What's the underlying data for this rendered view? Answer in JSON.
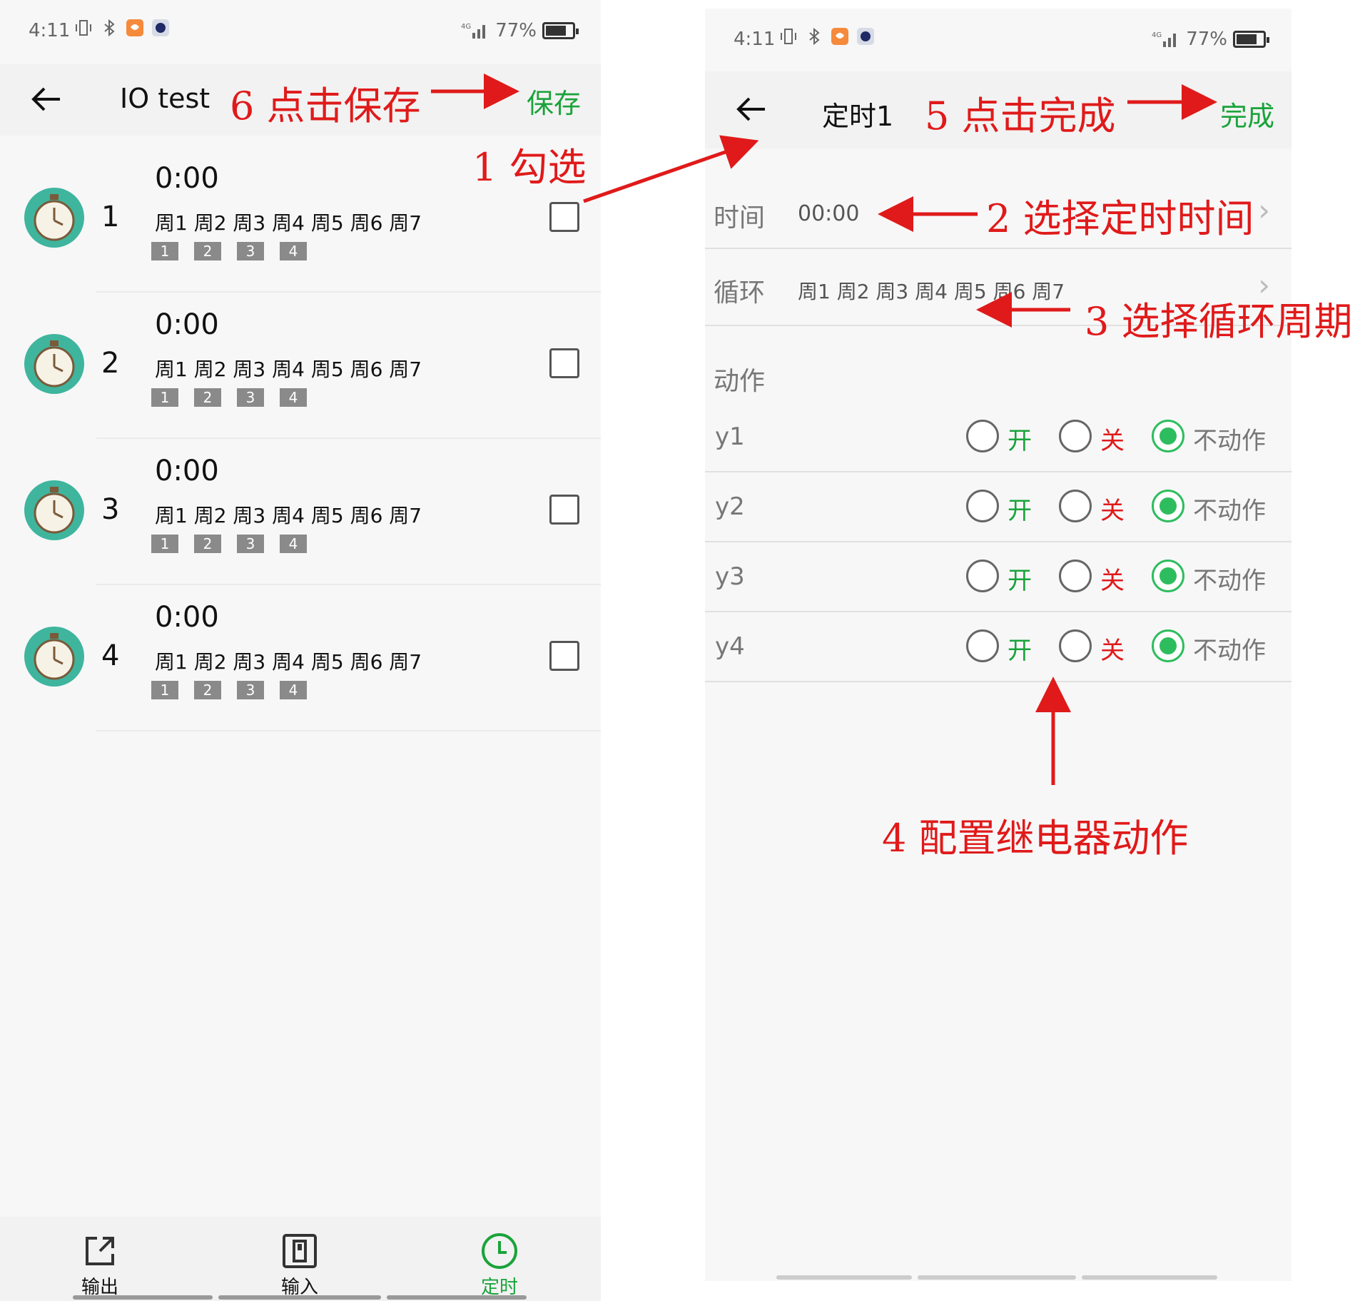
{
  "left": {
    "status": {
      "time": "4:11",
      "signal": "4G",
      "battery": "77%"
    },
    "toolbar": {
      "title": "IO test",
      "save": "保存"
    },
    "timers": [
      {
        "index": "1",
        "time": "0:00",
        "days": "周1 周2 周3 周4 周5 周6 周7",
        "relays": [
          "1",
          "2",
          "3",
          "4"
        ]
      },
      {
        "index": "2",
        "time": "0:00",
        "days": "周1 周2 周3 周4 周5 周6 周7",
        "relays": [
          "1",
          "2",
          "3",
          "4"
        ]
      },
      {
        "index": "3",
        "time": "0:00",
        "days": "周1 周2 周3 周4 周5 周6 周7",
        "relays": [
          "1",
          "2",
          "3",
          "4"
        ]
      },
      {
        "index": "4",
        "time": "0:00",
        "days": "周1 周2 周3 周4 周5 周6 周7",
        "relays": [
          "1",
          "2",
          "3",
          "4"
        ]
      }
    ],
    "nav": {
      "output": "输出",
      "input": "输入",
      "timer": "定时"
    }
  },
  "right": {
    "status": {
      "time": "4:11",
      "signal": "4G",
      "battery": "77%"
    },
    "toolbar": {
      "title": "定时1",
      "done": "完成"
    },
    "time_label": "时间",
    "time_value": "00:00",
    "cycle_label": "循环",
    "cycle_value": "周1 周2 周3 周4 周5 周6 周7",
    "action_label": "动作",
    "options": {
      "on": "开",
      "off": "关",
      "none": "不动作"
    },
    "actions": [
      {
        "name": "y1",
        "selected": "none"
      },
      {
        "name": "y2",
        "selected": "none"
      },
      {
        "name": "y3",
        "selected": "none"
      },
      {
        "name": "y4",
        "selected": "none"
      }
    ]
  },
  "annotations": {
    "a1": "1  勾选",
    "a2": "2  选择定时时间",
    "a3": "3  选择循环周期",
    "a4": "4  配置继电器动作",
    "a5": "5  点击完成",
    "a6": "6  点击保存"
  },
  "colors": {
    "accent_green": "#1aa33a",
    "annotation_red": "#e01a1a",
    "radio_green": "#2ebd5e",
    "clock_teal": "#3fb59e"
  }
}
